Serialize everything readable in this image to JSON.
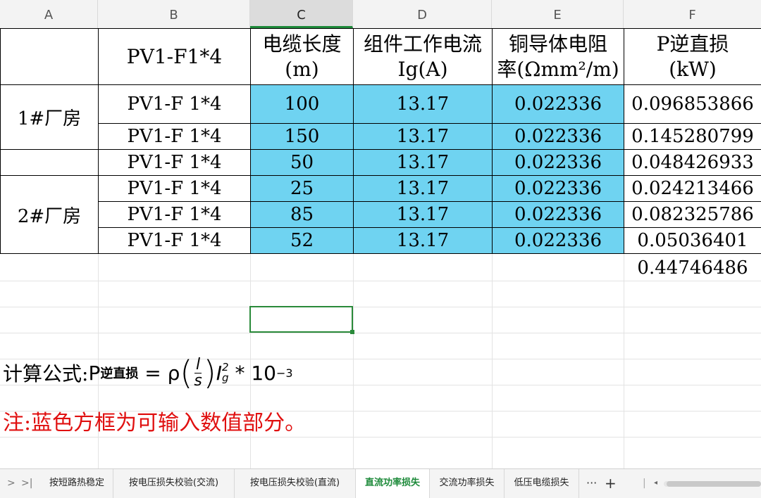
{
  "columns": [
    "A",
    "B",
    "C",
    "D",
    "E",
    "F"
  ],
  "active_column": "C",
  "header": {
    "b": "PV1-F1*4",
    "c1": "电缆长度",
    "c2": "(m)",
    "d1": "组件工作电流",
    "d2": "Ig(A)",
    "e1": "铜导体电阻",
    "e2": "率(Ωmm²/m)",
    "f1": "P逆直损",
    "f2": "(kW)"
  },
  "rows": [
    {
      "a": "1#厂房",
      "b": "PV1-F  1*4",
      "c": "100",
      "d": "13.17",
      "e": "0.022336",
      "f": "0.096853866"
    },
    {
      "a": "",
      "b": "PV1-F  1*4",
      "c": "150",
      "d": "13.17",
      "e": "0.022336",
      "f": "0.145280799"
    },
    {
      "a": "",
      "b": "PV1-F  1*4",
      "c": "50",
      "d": "13.17",
      "e": "0.022336",
      "f": "0.048426933"
    },
    {
      "a": "2#厂房",
      "b": "PV1-F  1*4",
      "c": "25",
      "d": "13.17",
      "e": "0.022336",
      "f": "0.024213466"
    },
    {
      "a": "",
      "b": "PV1-F  1*4",
      "c": "85",
      "d": "13.17",
      "e": "0.022336",
      "f": "0.082325786"
    },
    {
      "a": "",
      "b": "PV1-F  1*4",
      "c": "52",
      "d": "13.17",
      "e": "0.022336",
      "f": "0.05036401"
    }
  ],
  "total": "0.44746486",
  "formula": {
    "label": "计算公式:",
    "p": "P",
    "p_sub": "逆直损",
    "eq": "= ρ",
    "frac_num": "l",
    "frac_den": "s",
    "ig": "I",
    "ig_sup": "2",
    "ig_sub": "g",
    "tail": "* 10",
    "exp": "−3"
  },
  "note": "注:蓝色方框为可输入数值部分。",
  "sheet_tabs": [
    "按短路热稳定",
    "按电压损失校验(交流)",
    "按电压损失校验(直流)",
    "直流功率损失",
    "交流功率损失",
    "低压电缆损失"
  ],
  "active_tab": "直流功率损失",
  "tab_overflow": "···",
  "tab_add": "+",
  "colors": {
    "input_fill": "#6fd3f1",
    "note": "#e01010",
    "accent": "#1d8a3a"
  }
}
